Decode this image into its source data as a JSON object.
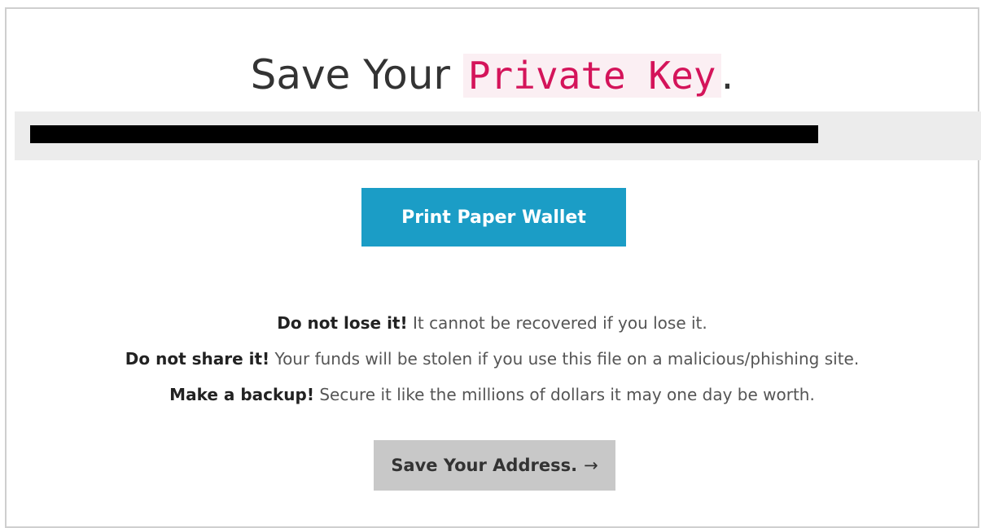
{
  "header": {
    "title_prefix": "Save Your ",
    "title_key": "Private Key",
    "title_suffix": "."
  },
  "private_key": {
    "value": "",
    "redacted": true
  },
  "buttons": {
    "print_paper_wallet": "Print Paper Wallet",
    "save_address": "Save Your Address.",
    "save_address_arrow": "→"
  },
  "warnings": [
    {
      "strong": "Do not lose it!",
      "text": " It cannot be recovered if you lose it."
    },
    {
      "strong": "Do not share it!",
      "text": " Your funds will be stolen if you use this file on a malicious/phishing site."
    },
    {
      "strong": "Make a backup!",
      "text": " Secure it like the millions of dollars it may one day be worth."
    }
  ],
  "colors": {
    "primary_button": "#1b9dc6",
    "secondary_button": "#c8c8c8",
    "key_highlight_text": "#d4145a",
    "key_highlight_bg": "#fbeff3"
  }
}
